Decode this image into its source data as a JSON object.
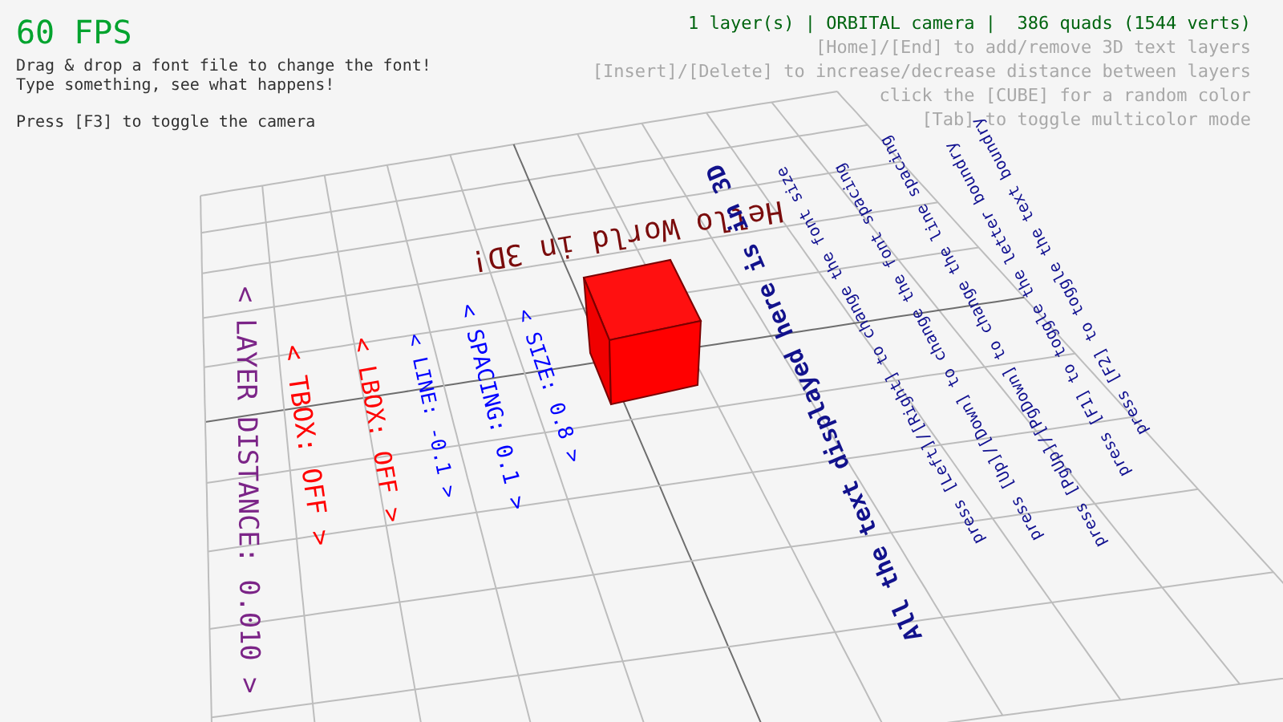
{
  "fps": "60 FPS",
  "instructions": [
    "Drag & drop a font file to change the font!",
    "Type something, see what happens!"
  ],
  "camera_hint": "Press [F3] to toggle the camera",
  "status": "1 layer(s) | ORBITAL camera |  386 quads (1544 verts)",
  "key_hints": [
    "[Home]/[End] to add/remove 3D text layers",
    "[Insert]/[Delete] to increase/decrease distance between layers",
    "click the [CUBE] for a random color",
    "[Tab] to toggle multicolor mode"
  ],
  "scene": {
    "hello_text": "Hello World in 3D!",
    "info_text": "All the text displayed here is in 3D",
    "help_lines": [
      "press [Left]/[Right] to change the font size",
      "press [Up]/[Down] to change the font spacing",
      "press [PgUp]/[PgDown] to change the line spacing",
      "press [F1] to toggle the letter boundry",
      "press [F2] to toggle the text boundry"
    ],
    "settings": [
      {
        "label": "< SIZE: 0.8 >",
        "color": "#0000ff"
      },
      {
        "label": "< SPACING: 0.1 >",
        "color": "#0000ff"
      },
      {
        "label": "< LINE: -0.1 >",
        "color": "#0000ff"
      },
      {
        "label": "< LBOX: OFF >",
        "color": "#ff0000"
      },
      {
        "label": "< TBOX: OFF >",
        "color": "#ff0000"
      },
      {
        "label": "< LAYER DISTANCE: 0.010 >",
        "color": "#7b2487"
      }
    ]
  }
}
